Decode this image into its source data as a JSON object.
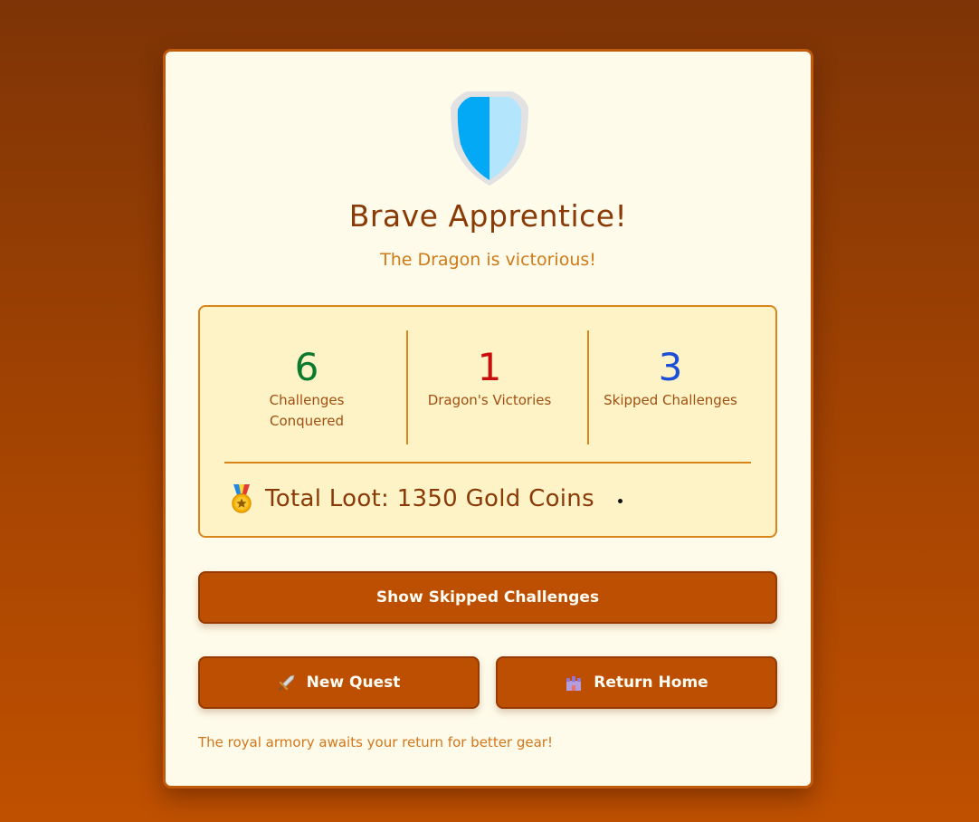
{
  "colors": {
    "accent": "#bd4f02",
    "title": "#8a3a06",
    "conquered": "#0b7a2e",
    "dragon_victories": "#c80d0d",
    "skipped": "#1c4ed8"
  },
  "result": {
    "badge_icon": "shield-icon",
    "title": "Brave Apprentice!",
    "subtitle": "The Dragon is victorious!"
  },
  "stats": [
    {
      "value": "6",
      "label": "Challenges Conquered",
      "color": "#0b7a2e"
    },
    {
      "value": "1",
      "label": "Dragon's Victories",
      "color": "#c80d0d"
    },
    {
      "value": "3",
      "label": "Skipped Challenges",
      "color": "#1c4ed8"
    }
  ],
  "loot": {
    "icon": "medal-icon",
    "text": "Total Loot: 1350 Gold Coins"
  },
  "buttons": {
    "show_skipped": "Show Skipped Challenges",
    "new_quest": "New Quest",
    "new_quest_icon": "sword-icon",
    "return_home": "Return Home",
    "return_home_icon": "castle-icon"
  },
  "footer": {
    "note": "The royal armory awaits your return for better gear!"
  }
}
